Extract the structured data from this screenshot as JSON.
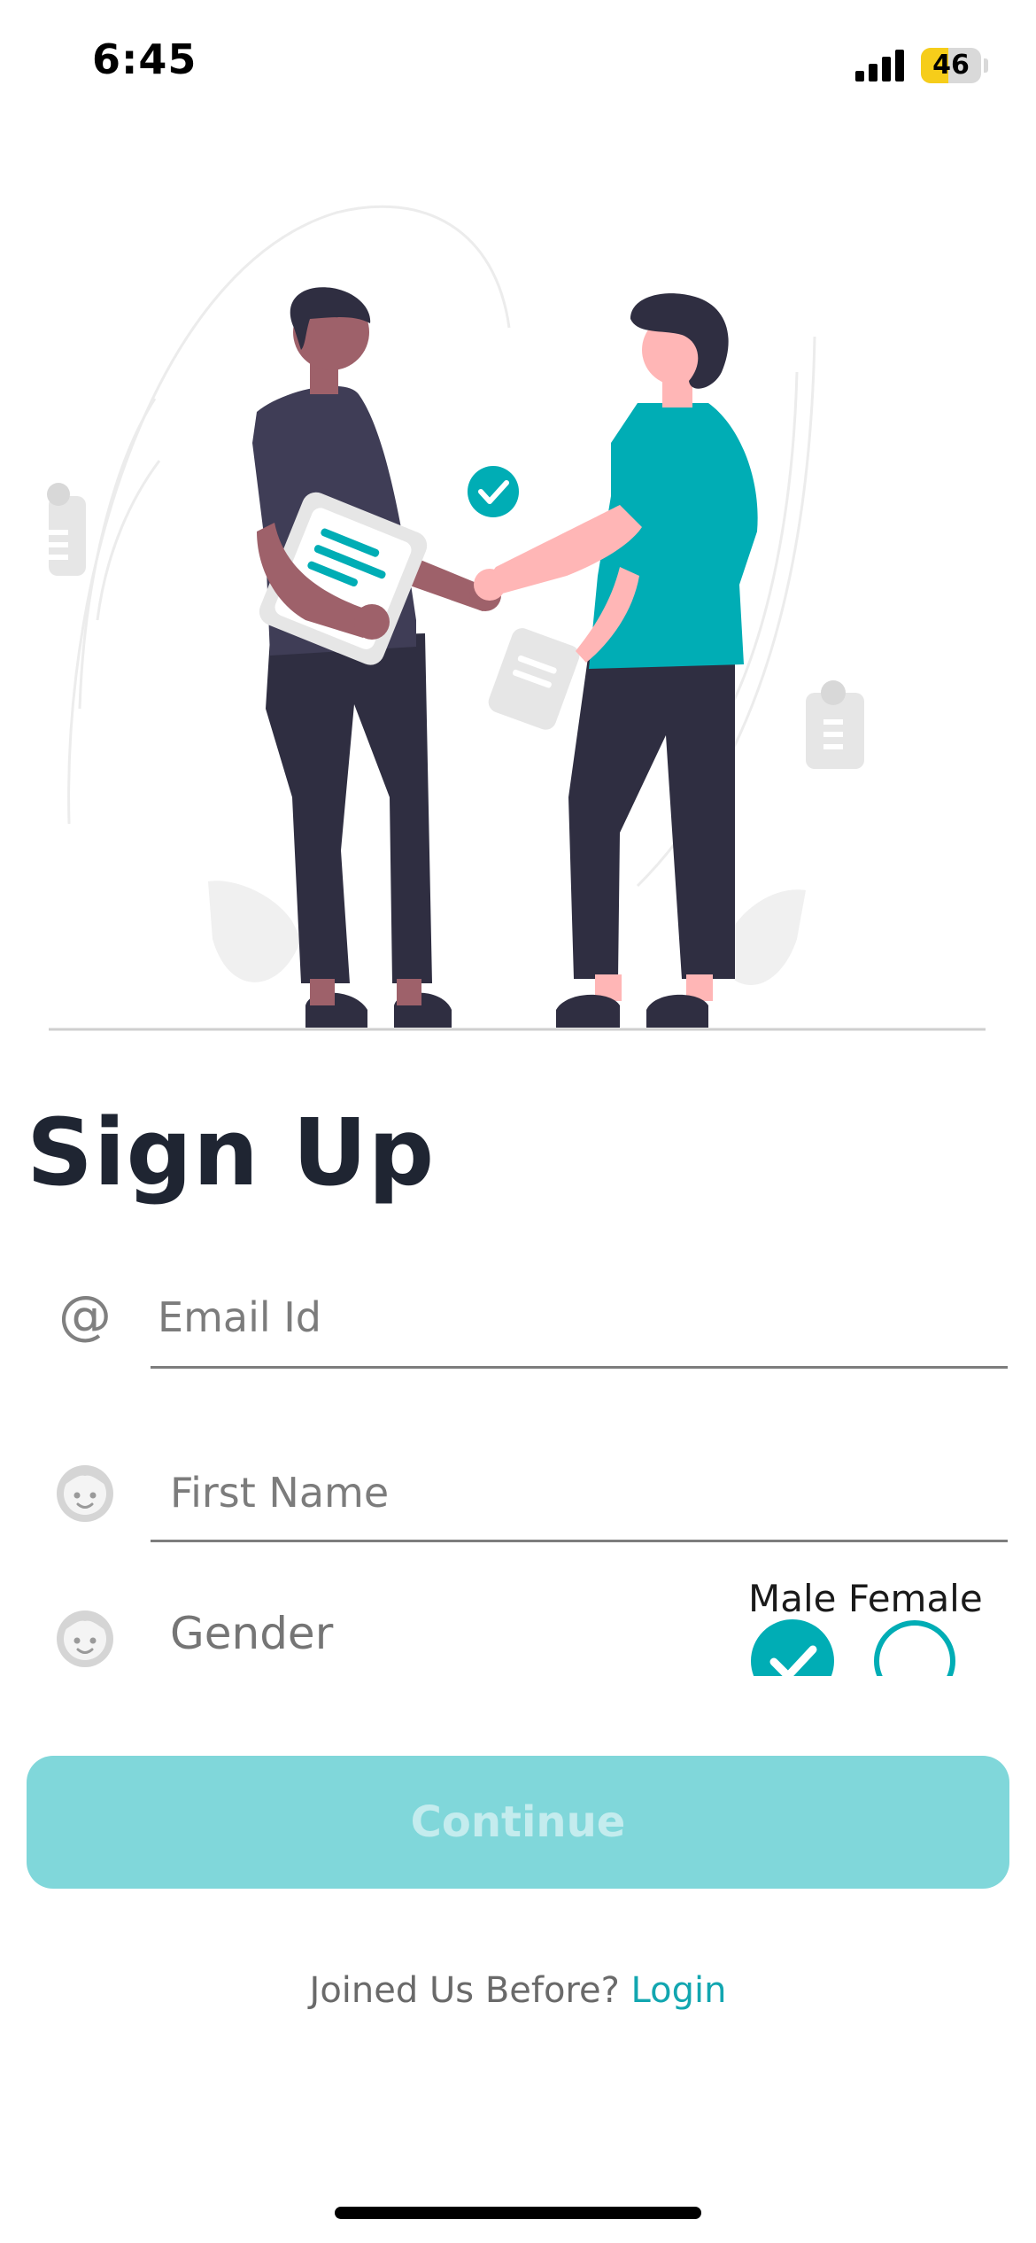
{
  "status_bar": {
    "time": "6:45",
    "battery_level": "46",
    "battery_fraction": 0.46,
    "battery_color": "#f6cd1a"
  },
  "illustration": {
    "name": "handshake-illustration",
    "accent_color": "#00adb5"
  },
  "page": {
    "title": "Sign Up"
  },
  "form": {
    "email": {
      "placeholder": "Email Id",
      "value": "",
      "icon": "at-icon"
    },
    "first_name": {
      "placeholder": "First Name",
      "value": "",
      "icon": "face-icon"
    },
    "gender": {
      "label": "Gender",
      "icon": "face-icon",
      "options_label": "Male Female",
      "options": [
        {
          "label": "Male",
          "selected": true
        },
        {
          "label": "Female",
          "selected": false
        }
      ]
    }
  },
  "actions": {
    "continue_label": "Continue",
    "login_prompt": "Joined Us Before?",
    "login_link": "Login"
  },
  "colors": {
    "accent": "#00adb5",
    "button_disabled_bg": "#80d7da",
    "title": "#1f2532"
  }
}
